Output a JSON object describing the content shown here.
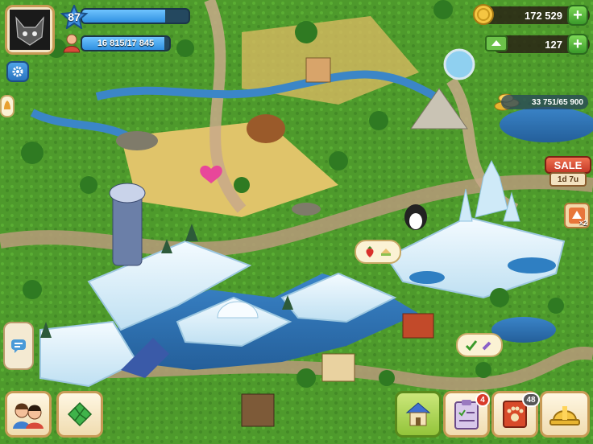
{
  "player": {
    "level": "87",
    "xp_progress": 0.78,
    "population_text": "16 815/17 845",
    "population_progress": 0.94
  },
  "resources": {
    "coins": "172 529",
    "tickets": "127",
    "collectable_gold": "33 751/65 900"
  },
  "sale": {
    "label": "SALE",
    "timer": "1d 7u"
  },
  "boost": {
    "multiplier": "×2"
  },
  "bottom_bar": {
    "tasks_badge": "4",
    "zoopedia_badge": "48"
  },
  "icons": {
    "settings": "gear-icon",
    "chat": "chat-icon",
    "friends": "friends-icon",
    "clover": "clover-icon",
    "shop": "shop-icon",
    "tasks": "clipboard-icon",
    "zoopedia": "paw-book-icon",
    "build": "hard-hat-icon"
  },
  "colors": {
    "accent_blue": "#2f8fe0",
    "plus_green": "#3a9a2a",
    "sale_red": "#c43a28",
    "badge_red": "#d93a2a"
  }
}
